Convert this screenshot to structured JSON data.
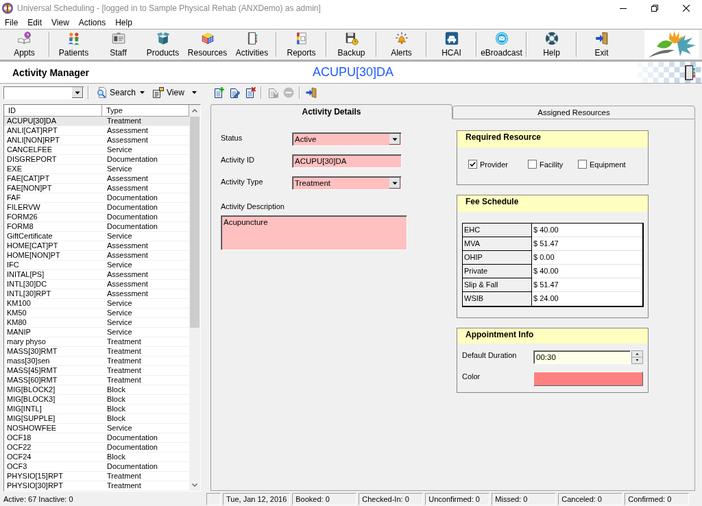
{
  "window": {
    "title": "Universal Scheduling - [logged in to Sample Physical Rehab (ANXDemo) as admin]"
  },
  "menu": [
    "File",
    "Edit",
    "View",
    "Actions",
    "Help"
  ],
  "toolbar": [
    [
      "Appts"
    ],
    [
      "Patients",
      "Staff",
      "Products",
      "Resources",
      "Activities"
    ],
    [
      "Reports"
    ],
    [
      "Backup"
    ],
    [
      "Alerts"
    ],
    [
      "HCAI"
    ],
    [
      "eBroadcast"
    ],
    [
      "Help"
    ],
    [
      "Exit"
    ]
  ],
  "header": {
    "title": "Activity Manager",
    "record": "ACUPU[30]DA"
  },
  "list_toolbar": {
    "search": "Search",
    "view": "View"
  },
  "activity_list": {
    "columns": [
      "ID",
      "Type"
    ],
    "rows": [
      {
        "id": "ACUPU[30]DA",
        "type": "Treatment",
        "selected": true
      },
      {
        "id": "ANLI[CAT]RPT",
        "type": "Assessment",
        "selected": false
      },
      {
        "id": "ANLI[NON]RPT",
        "type": "Assessment",
        "selected": false
      },
      {
        "id": "CANCELFEE",
        "type": "Service",
        "selected": false
      },
      {
        "id": "DISGREPORT",
        "type": "Documentation",
        "selected": false
      },
      {
        "id": "EXE",
        "type": "Service",
        "selected": false
      },
      {
        "id": "FAE[CAT]PT",
        "type": "Assessment",
        "selected": false
      },
      {
        "id": "FAE[NON]PT",
        "type": "Assessment",
        "selected": false
      },
      {
        "id": "FAF",
        "type": "Documentation",
        "selected": false
      },
      {
        "id": "FILERVW",
        "type": "Documentation",
        "selected": false
      },
      {
        "id": "FORM26",
        "type": "Documentation",
        "selected": false
      },
      {
        "id": "FORM8",
        "type": "Documentation",
        "selected": false
      },
      {
        "id": "GiftCertificate",
        "type": "Service",
        "selected": false
      },
      {
        "id": "HOME[CAT]PT",
        "type": "Assessment",
        "selected": false
      },
      {
        "id": "HOME[NON]PT",
        "type": "Assessment",
        "selected": false
      },
      {
        "id": "IFC",
        "type": "Service",
        "selected": false
      },
      {
        "id": "INITAL[PS]",
        "type": "Assessment",
        "selected": false
      },
      {
        "id": "INTL[30]DC",
        "type": "Assessment",
        "selected": false
      },
      {
        "id": "INTL[30]RPT",
        "type": "Assessment",
        "selected": false
      },
      {
        "id": "KM100",
        "type": "Service",
        "selected": false
      },
      {
        "id": "KM50",
        "type": "Service",
        "selected": false
      },
      {
        "id": "KM80",
        "type": "Service",
        "selected": false
      },
      {
        "id": "MANIP",
        "type": "Service",
        "selected": false
      },
      {
        "id": "mary physo",
        "type": "Treatment",
        "selected": false
      },
      {
        "id": "MASS[30]RMT",
        "type": "Treatment",
        "selected": false
      },
      {
        "id": "mass[30]sen",
        "type": "Treatment",
        "selected": false
      },
      {
        "id": "MASS[45]RMT",
        "type": "Treatment",
        "selected": false
      },
      {
        "id": "MASS[60]RMT",
        "type": "Treatment",
        "selected": false
      },
      {
        "id": "MIG[BLOCK2]",
        "type": "Block",
        "selected": false
      },
      {
        "id": "MIG[BLOCK3]",
        "type": "Block",
        "selected": false
      },
      {
        "id": "MIG[INTL]",
        "type": "Block",
        "selected": false
      },
      {
        "id": "MIG[SUPPLE]",
        "type": "Block",
        "selected": false
      },
      {
        "id": "NOSHOWFEE",
        "type": "Service",
        "selected": false
      },
      {
        "id": "OCF18",
        "type": "Documentation",
        "selected": false
      },
      {
        "id": "OCF22",
        "type": "Documentation",
        "selected": false
      },
      {
        "id": "OCF24",
        "type": "Block",
        "selected": false
      },
      {
        "id": "OCF3",
        "type": "Documentation",
        "selected": false
      },
      {
        "id": "PHYSIO[15]RPT",
        "type": "Treatment",
        "selected": false
      },
      {
        "id": "PHYSIO[30]RPT",
        "type": "Treatment",
        "selected": false
      }
    ]
  },
  "action_toolbar": [
    [
      {
        "disabled": false
      },
      {
        "disabled": false
      },
      {
        "disabled": false
      }
    ],
    [
      {
        "disabled": true
      },
      {
        "disabled": true
      }
    ],
    [
      {
        "disabled": false
      }
    ]
  ],
  "tabs": [
    {
      "label": "Activity Details",
      "selected": true
    },
    {
      "label": "Assigned Resources",
      "selected": false
    }
  ],
  "form": [
    {
      "kind": "dropdown",
      "label": "Status",
      "value": "Active"
    },
    {
      "kind": "input",
      "label": "Activity ID",
      "value": "ACUPU[30]DA"
    },
    {
      "kind": "dropdown",
      "label": "Activity Type",
      "value": "Treatment"
    },
    {
      "kind": "textarea",
      "label": "Activity Description",
      "value": "Acupuncture"
    }
  ],
  "required_resource": {
    "title": "Required Resource",
    "options": [
      {
        "label": "Provider",
        "checked": true
      },
      {
        "label": "Facility",
        "checked": false
      },
      {
        "label": "Equipment",
        "checked": false
      }
    ]
  },
  "fee_schedule": {
    "title": "Fee Schedule",
    "rows": [
      [
        "EHC",
        "$ 40.00"
      ],
      [
        "MVA",
        "$ 51.47"
      ],
      [
        "OHIP",
        "$ 0.00"
      ],
      [
        "Private",
        "$ 40.00"
      ],
      [
        "Slip & Fall",
        "$ 51.47"
      ],
      [
        "WSIB",
        "$ 24.00"
      ]
    ]
  },
  "appointment_info": {
    "title": "Appointment Info",
    "duration": {
      "label": "Default Duration",
      "value": "00:30"
    },
    "color": {
      "label": "Color",
      "color": "#ff8080"
    }
  },
  "status_bar": [
    "Active: 67 Inactive: 0",
    "Tue, Jan 12, 2016",
    "Booked: 0",
    "Checked-In: 0",
    "Unconfirmed: 0",
    "Missed: 0",
    "Canceled: 0",
    "Confirmed: 0"
  ]
}
